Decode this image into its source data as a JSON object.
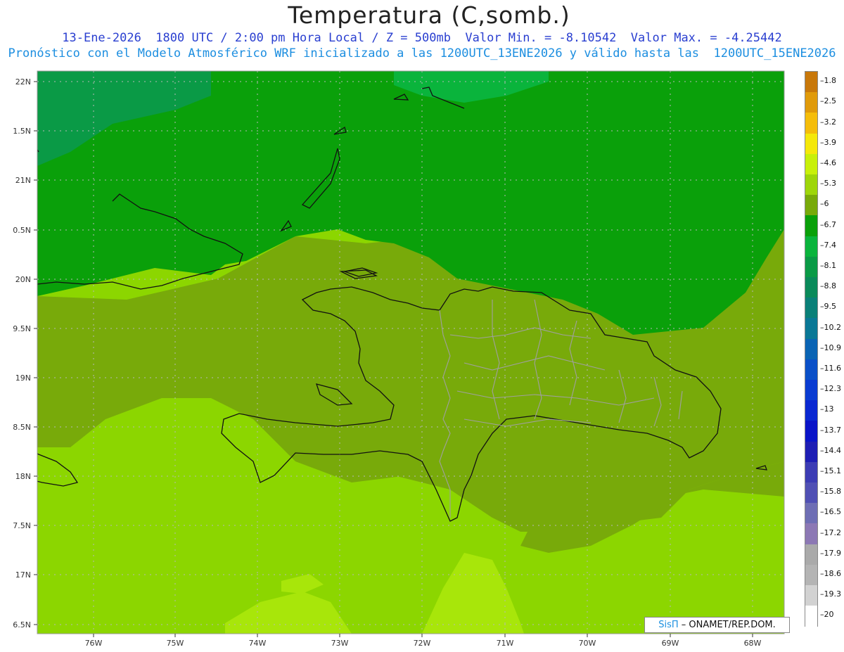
{
  "title": "Temperatura (C,somb.)",
  "subtitle_line1": "13-Ene-2026  1800 UTC / 2:00 pm Hora Local / Z = 500mb  Valor Min. = -8.10542  Valor Max. = -4.25442",
  "subtitle_line2": "Pronóstico con el Modelo Atmosférico WRF inicializado a las 1200UTC_13ENE2026 y válido hasta las  1200UTC_15ENE2026",
  "lat_labels": [
    "22N",
    "1.5N",
    "21N",
    "0.5N",
    "20N",
    "9.5N",
    "19N",
    "8.5N",
    "18N",
    "7.5N",
    "17N",
    "6.5N"
  ],
  "lon_labels": [
    "76W",
    "75W",
    "74W",
    "73W",
    "72W",
    "71W",
    "70W",
    "69W",
    "68W"
  ],
  "credit": {
    "sis": "SisΠ",
    "rest": "– ONAMET/REP.DOM."
  },
  "colorbar": {
    "labels": [
      "-1.8",
      "-2.5",
      "-3.2",
      "-3.9",
      "-4.6",
      "-5.3",
      "-6",
      "-6.7",
      "-7.4",
      "-8.1",
      "-8.8",
      "-9.5",
      "-10.2",
      "-10.9",
      "-11.6",
      "-12.3",
      "-13",
      "-13.7",
      "-14.4",
      "-15.1",
      "-15.8",
      "-16.5",
      "-17.2",
      "-17.9",
      "-18.6",
      "-19.3",
      "-20"
    ],
    "colors": [
      "#c8780a",
      "#e09a0a",
      "#f5bd0a",
      "#f5e80a",
      "#c8f00a",
      "#9ed60a",
      "#78aa0a",
      "#0aa00a",
      "#0ab43c",
      "#0a9a46",
      "#0a8a5a",
      "#0a8078",
      "#0a7896",
      "#0a64b4",
      "#0a50c8",
      "#0a3cd2",
      "#0a28d2",
      "#0a14c8",
      "#1e1eb4",
      "#3c3cb4",
      "#5050b4",
      "#6e6eb4",
      "#8c78b4",
      "#aaaaaa",
      "#b4b4b4",
      "#d2d2d2",
      "#ffffff"
    ]
  },
  "colors": {
    "cold_green": "#1aa81a",
    "mid_green": "#5eb40a",
    "olive": "#78aa0a",
    "light_green": "#8cd600",
    "yellow_green": "#a8e60a",
    "coast": "#111111",
    "border": "#a0a0a0"
  }
}
